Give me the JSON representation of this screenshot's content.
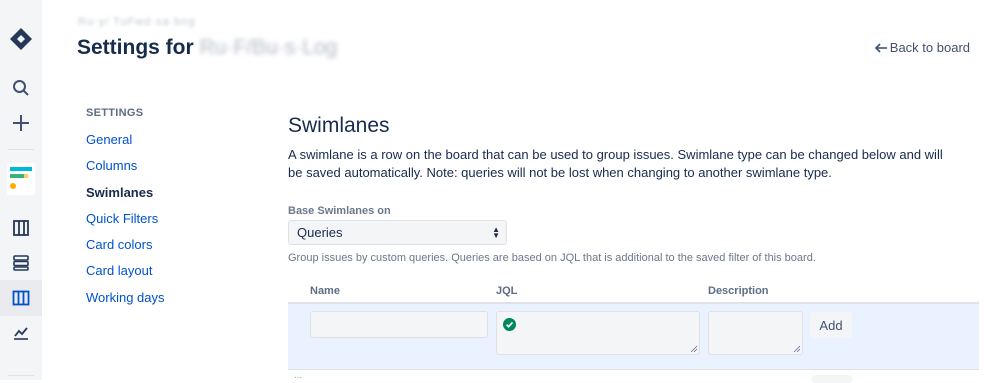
{
  "sidebar": {
    "icons": [
      "jira-logo-icon",
      "search-icon",
      "plus-icon",
      "project-avatar-icon",
      "backlog-icon",
      "releases-icon",
      "board-icon",
      "reports-icon"
    ]
  },
  "header": {
    "breadcrumb": "Ru·y/ TuFwd·sa·bng",
    "title_prefix": "Settings for",
    "title_project": "Ru·F/Bu·s·Log",
    "back_link": "Back to board"
  },
  "settings_nav": {
    "heading": "SETTINGS",
    "items": [
      {
        "label": "General",
        "active": false
      },
      {
        "label": "Columns",
        "active": false
      },
      {
        "label": "Swimlanes",
        "active": true
      },
      {
        "label": "Quick Filters",
        "active": false
      },
      {
        "label": "Card colors",
        "active": false
      },
      {
        "label": "Card layout",
        "active": false
      },
      {
        "label": "Working days",
        "active": false
      }
    ]
  },
  "main": {
    "title": "Swimlanes",
    "description": "A swimlane is a row on the board that can be used to group issues. Swimlane type can be changed below and will be saved automatically. Note: queries will not be lost when changing to another swimlane type.",
    "base_label": "Base Swimlanes on",
    "base_value": "Queries",
    "help_text": "Group issues by custom queries. Queries are based on JQL that is additional to the saved filter of this board.",
    "table": {
      "headers": {
        "name": "Name",
        "jql": "JQL",
        "description": "Description"
      },
      "new_row": {
        "name": "",
        "jql": "",
        "description": "",
        "add_label": "Add"
      }
    },
    "below_hint": "..."
  },
  "colors": {
    "brand": "#0052cc",
    "text": "#172b4d",
    "row_highlight": "#ebf2ff",
    "valid_green": "#00875a"
  }
}
